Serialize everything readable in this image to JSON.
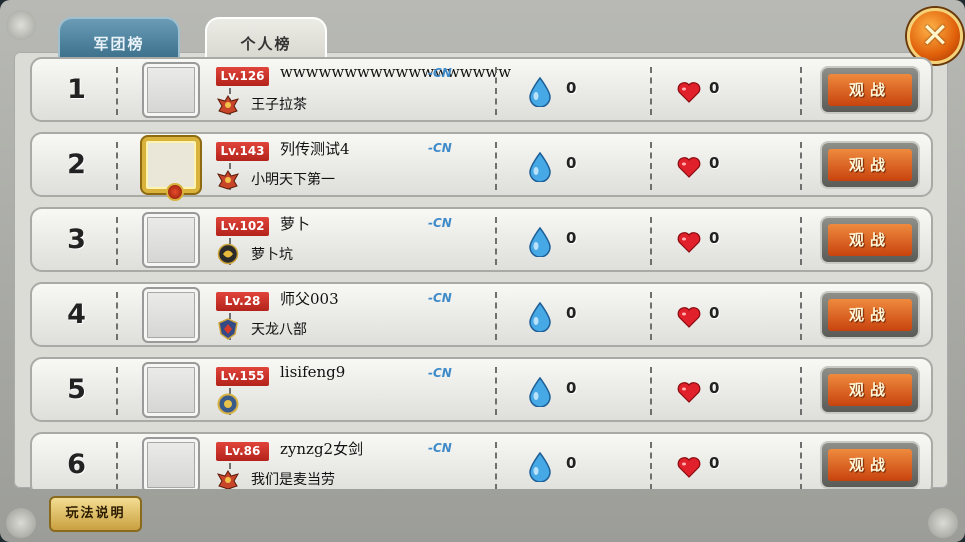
{
  "tabs": [
    {
      "label": "军团榜",
      "active": false
    },
    {
      "label": "个人榜",
      "active": true
    }
  ],
  "close_label": "✕",
  "watch_label": "观战",
  "help_label": "玩法说明",
  "colors": {
    "accent_orange": "#e0600a",
    "level_red": "#c8291f",
    "tab_blue": "#4a809c",
    "cn_blue": "#3f8bc9"
  },
  "rows": [
    {
      "rank": "1",
      "level": "Lv.126",
      "name": "wwwwwwwwwwwwwwwwww",
      "server": "-CN",
      "guild": "王子拉茶",
      "water": "0",
      "hearts": "0",
      "avatar_frame": "plain",
      "guild_icon": "winged-emblem-icon"
    },
    {
      "rank": "2",
      "level": "Lv.143",
      "name": "列传测试4",
      "server": "-CN",
      "guild": "小明天下第一",
      "water": "0",
      "hearts": "0",
      "avatar_frame": "gold",
      "guild_icon": "winged-emblem-icon"
    },
    {
      "rank": "3",
      "level": "Lv.102",
      "name": "萝卜",
      "server": "-CN",
      "guild": "萝卜坑",
      "water": "0",
      "hearts": "0",
      "avatar_frame": "plain",
      "guild_icon": "swirl-emblem-icon"
    },
    {
      "rank": "4",
      "level": "Lv.28",
      "name": "师父003",
      "server": "-CN",
      "guild": "天龙八部",
      "water": "0",
      "hearts": "0",
      "avatar_frame": "plain",
      "guild_icon": "shield-emblem-icon"
    },
    {
      "rank": "5",
      "level": "Lv.155",
      "name": "lisifeng9",
      "server": "-CN",
      "guild": "",
      "water": "0",
      "hearts": "0",
      "avatar_frame": "plain",
      "guild_icon": "round-emblem-icon"
    },
    {
      "rank": "6",
      "level": "Lv.86",
      "name": "zynzg2女剑",
      "server": "-CN",
      "guild": "我们是麦当劳",
      "water": "0",
      "hearts": "0",
      "avatar_frame": "plain",
      "guild_icon": "winged-emblem-icon"
    }
  ]
}
